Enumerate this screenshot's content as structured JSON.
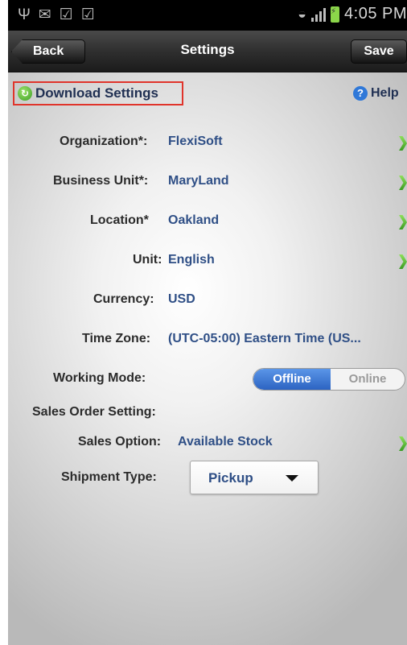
{
  "status_bar": {
    "time": "4:05 PM",
    "left_icons": [
      "usb-icon",
      "mail-icon",
      "checklist-icon",
      "checklist-icon"
    ],
    "right_icons": [
      "wifi-icon",
      "signal-icon",
      "battery-charging-icon"
    ]
  },
  "nav": {
    "title": "Settings",
    "back_label": "Back",
    "save_label": "Save"
  },
  "header": {
    "download_label": "Download Settings",
    "help_label": "Help",
    "download_icon_glyph": "↻",
    "help_icon_glyph": "?"
  },
  "form": {
    "organization": {
      "label": "Organization*:",
      "value": "FlexiSoft"
    },
    "business_unit": {
      "label": "Business Unit*:",
      "value": "MaryLand"
    },
    "location": {
      "label": "Location*",
      "value": "Oakland"
    },
    "unit": {
      "label": "Unit:",
      "value": "English"
    },
    "currency": {
      "label": "Currency:",
      "value": "USD"
    },
    "time_zone": {
      "label": "Time Zone:",
      "value": "(UTC-05:00) Eastern Time (US..."
    },
    "working_mode": {
      "label": "Working Mode:",
      "offline": "Offline",
      "online": "Online",
      "selected": "Offline"
    },
    "sales_order_heading": "Sales Order Setting:",
    "sales_option": {
      "label": "Sales Option:",
      "value": "Available Stock"
    },
    "shipment_type": {
      "label": "Shipment Type:",
      "value": "Pickup"
    }
  },
  "colors": {
    "accent": "#2f63c2",
    "value_text": "#2f4f86",
    "chevron": "#3a9b22",
    "highlight_border": "#e0342b"
  }
}
